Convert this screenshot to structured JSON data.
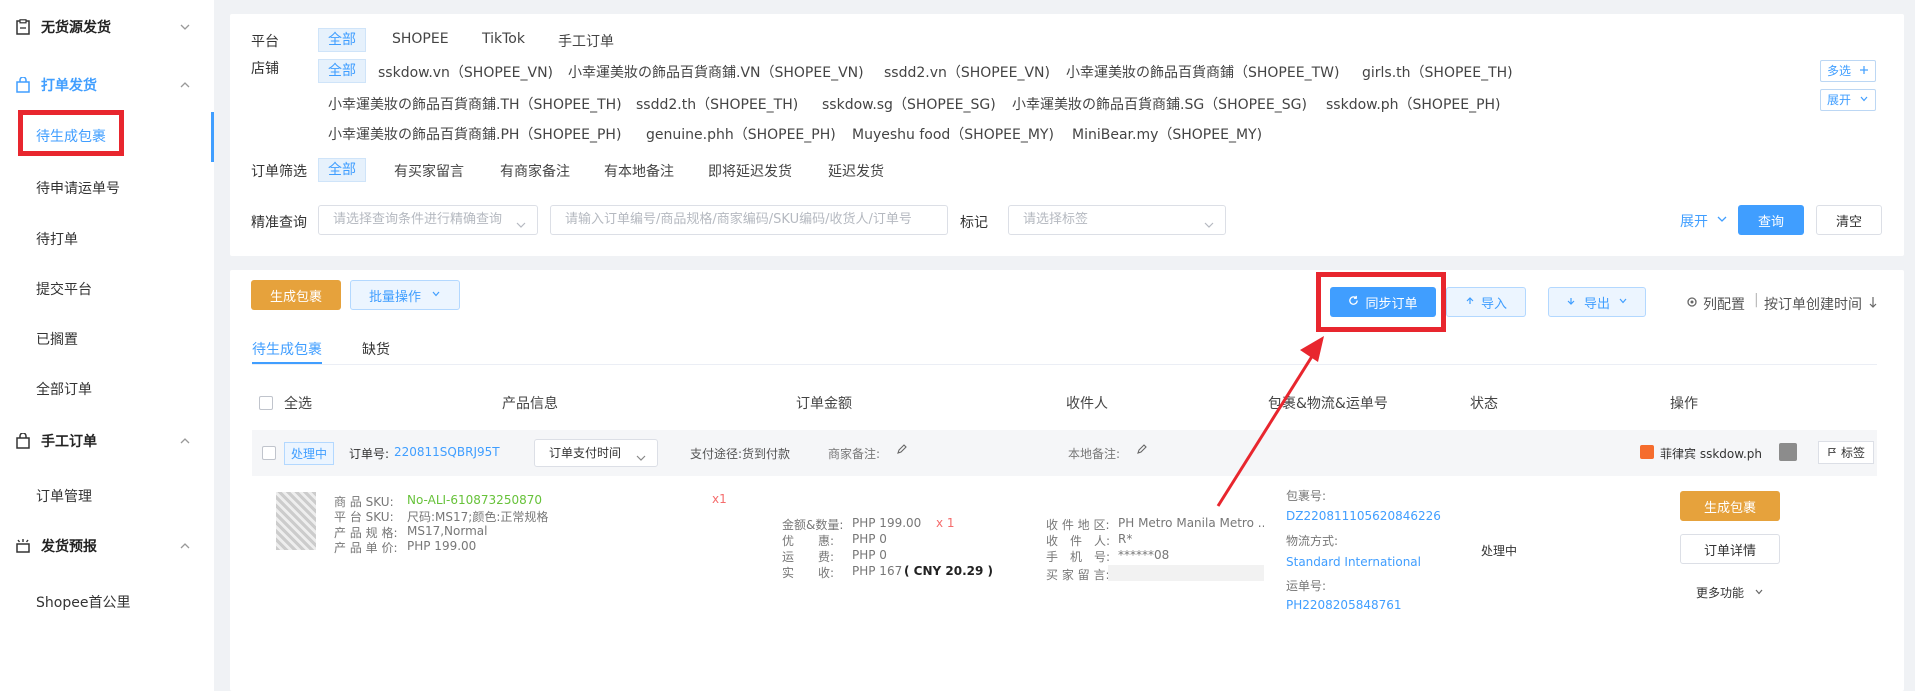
{
  "sidebar": {
    "groups": [
      {
        "label": "无货源发货",
        "icon": "clipboard-icon"
      },
      {
        "label": "打单发货",
        "icon": "bag-icon"
      },
      {
        "label": "手工订单",
        "icon": "bag-icon"
      },
      {
        "label": "发货预报",
        "icon": "alarm-icon"
      }
    ],
    "items": [
      "待生成包裹",
      "待申请运单号",
      "待打单",
      "提交平台",
      "已搁置",
      "全部订单",
      "订单管理",
      "Shopee首公里"
    ]
  },
  "filters": {
    "platform_label": "平台",
    "platforms": [
      "全部",
      "SHOPEE",
      "TikTok",
      "手工订单"
    ],
    "store_label": "店铺",
    "stores_row1": [
      "全部",
      "sskdow.vn（SHOPEE_VN)",
      "小幸運美妝の飾品百貨商鋪.VN（SHOPEE_VN)",
      "ssdd2.vn（SHOPEE_VN)",
      "小幸運美妝の飾品百貨商鋪（SHOPEE_TW)",
      "girls.th（SHOPEE_TH)"
    ],
    "stores_row2": [
      "小幸運美妝の飾品百貨商鋪.TH（SHOPEE_TH)",
      "ssdd2.th（SHOPEE_TH)",
      "sskdow.sg（SHOPEE_SG)",
      "小幸運美妝の飾品百貨商鋪.SG（SHOPEE_SG)",
      "sskdow.ph（SHOPEE_PH)"
    ],
    "stores_row3": [
      "小幸運美妝の飾品百貨商鋪.PH（SHOPEE_PH)",
      "genuine.phh（SHOPEE_PH)",
      "Muyeshu food（SHOPEE_MY)",
      "MiniBear.my（SHOPEE_MY)"
    ],
    "multi_select": "多选",
    "expand_store": "展开",
    "order_filter_label": "订单筛选",
    "order_filters": [
      "全部",
      "有买家留言",
      "有商家备注",
      "有本地备注",
      "即将延迟发货",
      "延迟发货"
    ],
    "exact_label": "精准查询",
    "exact_placeholder": "请选择查询条件进行精确查询",
    "order_no_placeholder": "请输入订单编号/商品规格/商家编码/SKU编码/收货人/订单号",
    "mark_label": "标记",
    "mark_placeholder": "请选择标签",
    "expand": "展开",
    "query": "查询",
    "clear": "清空"
  },
  "toolbar": {
    "generate": "生成包裹",
    "batch": "批量操作",
    "sync": "同步订单",
    "import": "导入",
    "export": "导出",
    "column_config": "列配置",
    "sort": "按订单创建时间"
  },
  "tabs": [
    "待生成包裹",
    "缺货"
  ],
  "table": {
    "headers": [
      "全选",
      "产品信息",
      "订单金额",
      "收件人",
      "包裹&物流&运单号",
      "状态",
      "操作"
    ]
  },
  "order": {
    "status_tag": "处理中",
    "order_no_label": "订单号:",
    "order_no": "220811SQBRJ95T",
    "time_select": "订单支付时间",
    "payment": "支付途径:货到付款",
    "merchant_note": "商家备注:",
    "local_note": "本地备注:",
    "store": "菲律宾 sskdow.ph",
    "tag_btn": "标签",
    "sku_label": "商 品 SKU:",
    "sku": "No-ALI-610873250870",
    "platform_sku_label": "平 台 SKU:",
    "platform_sku": "尺码:MS17;颜色:正常规格",
    "spec_label": "产 品 规 格:",
    "spec": "MS17,Normal",
    "price_label": "产 品 单 价:",
    "price": "PHP 199.00",
    "qty": "x1",
    "amount_label": "金额&数量:",
    "amount": "PHP 199.00",
    "amount_qty": "x 1",
    "discount_label": "优　　惠:",
    "discount": "PHP 0",
    "shipping_label": "运　　费:",
    "shipping": "PHP 0",
    "received_label": "实　　收:",
    "received": "PHP 167",
    "received_cny": "( CNY  20.29 )",
    "region_label": "收 件 地 区:",
    "region": "PH Metro Manila Metro ...",
    "receiver_label": "收　件　人:",
    "receiver": "R*",
    "phone_label": "手　机　号:",
    "phone": "******08",
    "buyer_msg_label": "买 家 留 言:",
    "package_label": "包裹号:",
    "package": "DZ220811105620846226",
    "logistics_label": "物流方式:",
    "logistics": "Standard International",
    "waybill_label": "运单号:",
    "waybill": "PH2208205848761",
    "status": "处理中",
    "op_generate": "生成包裹",
    "op_detail": "订单详情",
    "op_more": "更多功能"
  },
  "colors": {
    "primary": "#409eff",
    "orange": "#e6a23c",
    "highlight": "#e8262e"
  }
}
